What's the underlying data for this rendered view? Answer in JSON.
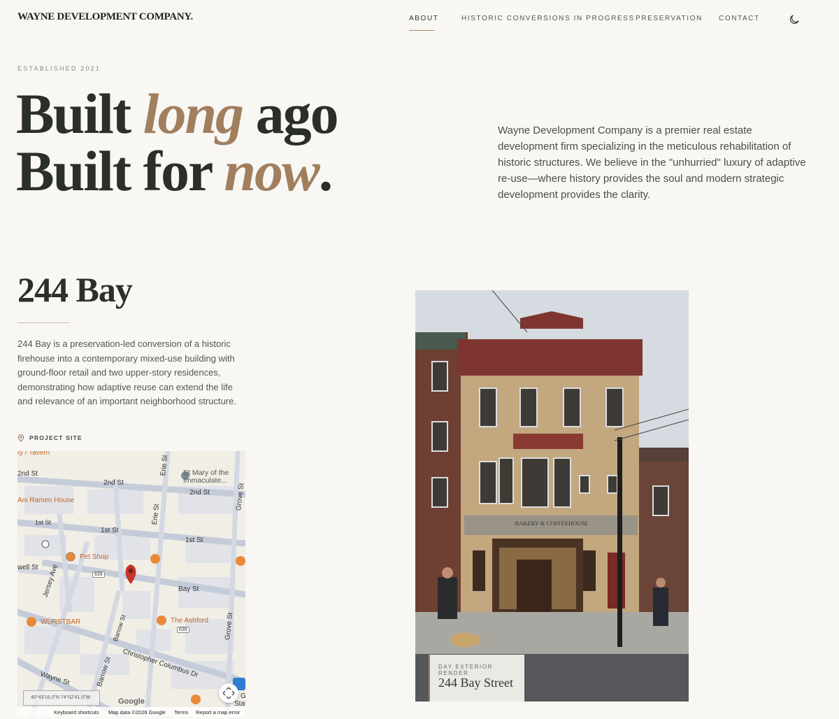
{
  "brand": {
    "logo": "WAYNE DEVELOPMENT COMPANY."
  },
  "nav": {
    "items": [
      "ABOUT",
      "HISTORIC CONVERSIONS IN PROGRESS",
      "PRESERVATION",
      "CONTACT"
    ],
    "active": "ABOUT"
  },
  "hero": {
    "kicker": "ESTABLISHED 2021",
    "line1_a": "Built ",
    "line1_accent": "long",
    "line1_b": " ago",
    "line2_a": "Built for ",
    "line2_accent": "now",
    "line2_b": ".",
    "intro": "Wayne Development Company is a premier real estate development firm specializing in the meticulous rehabilitation of historic structures. We believe in the \"unhurried\" luxury of adaptive re-use—where history provides the soul and modern strategic development provides the clarity."
  },
  "project": {
    "title": "244 Bay",
    "description": "244 Bay is a preservation-led conversion of a historic firehouse into a contemporary mixed-use building with ground-floor retail and two upper-story residences, demonstrating how adaptive reuse can extend the life and relevance of an important neighborhood structure.",
    "site_label": "PROJECT SITE"
  },
  "map": {
    "labels": {
      "tavern": "ky / Tavern",
      "second_st_a": "2nd St",
      "second_st_b": "2nd St",
      "second_st_c": "2nd St",
      "erie_st_a": "Erie St",
      "erie_st_b": "Erie St",
      "st_mary_1": "St Mary of the",
      "st_mary_2": "Immaculate...",
      "ramen": "Ani Ramen House",
      "first_st_a": "1st St",
      "first_st_b": "1st St",
      "first_st_c": "1st St",
      "grove_st_a": "Grove St",
      "grove_st_b": "Grove St",
      "pet_shop": "Pet Shop",
      "well_st": "well St",
      "jersey_ave": "Jersey Ave",
      "bay_st": "Bay St",
      "wurstbar": "WÜRSTBAR",
      "ashford": "The Ashford",
      "barrow_st_a": "Barrow St",
      "barrow_st_b": "Barrow St",
      "columbus": "Christopher Columbus Dr",
      "wayne_st": "Wayne St",
      "route_a": "639",
      "route_b": "639",
      "station_1": "G",
      "station_2": "Stat"
    },
    "coords": "40°43'16.0\"N 74°02'41.0\"W",
    "google": "Google",
    "footer": {
      "shortcuts": "Keyboard shortcuts",
      "mapdata": "Map data ©2026 Google",
      "terms": "Terms",
      "report": "Report a map error"
    }
  },
  "photo": {
    "sign": "BAKERY & COFFEEHOUSE",
    "caption_kicker": "DAY EXTERIOR RENDER",
    "caption_title": "244 Bay Street"
  },
  "colors": {
    "accent": "#a17f5e",
    "background": "#f8f7f4",
    "text": "#2a2f2a"
  }
}
